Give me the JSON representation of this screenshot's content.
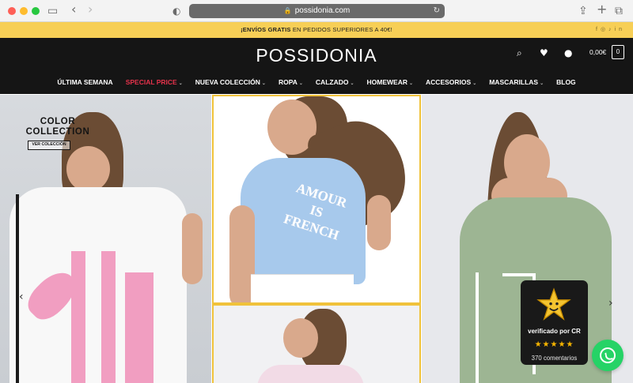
{
  "browser": {
    "url": "possidonia.com",
    "icons": [
      "sidebar-icon",
      "back-icon",
      "forward-icon",
      "shield-icon",
      "share-icon",
      "new-tab-icon",
      "tabs-icon",
      "reload-icon",
      "lock-icon"
    ]
  },
  "promo": {
    "bold": "¡ENVÍOS GRATIS",
    "rest": " EN PEDIDOS SUPERIORES A 40€!",
    "social_icons": [
      "facebook-icon",
      "instagram-icon",
      "tiktok-icon",
      "linkedin-icon"
    ]
  },
  "header": {
    "logo": "POSSIDONIA",
    "cart_total": "0,00€",
    "cart_count": "0",
    "icons": [
      "search-icon",
      "heart-icon",
      "user-icon",
      "cart-icon"
    ]
  },
  "nav": {
    "items": [
      {
        "label": "ÚLTIMA SEMANA",
        "dropdown": false
      },
      {
        "label": "SPECIAL PRICE",
        "dropdown": true,
        "active": true
      },
      {
        "label": "NUEVA COLECCIÓN",
        "dropdown": true
      },
      {
        "label": "ROPA",
        "dropdown": true
      },
      {
        "label": "CALZADO",
        "dropdown": true
      },
      {
        "label": "HOMEWEAR",
        "dropdown": true
      },
      {
        "label": "ACCESORIOS",
        "dropdown": true
      },
      {
        "label": "MASCARILLAS",
        "dropdown": true
      },
      {
        "label": "BLOG",
        "dropdown": false
      }
    ]
  },
  "hero": {
    "collection_line1": "COLOR",
    "collection_line2": "COLLECTION",
    "button": "VER COLECCIÓN",
    "tee_line1": "AMOUR",
    "tee_line2": "IS",
    "tee_line3": "FRENCH",
    "next_arrow": "›"
  },
  "review": {
    "verified": "verificado por CR",
    "rating": 5,
    "stars": "★★★★★",
    "count": "370 comentarios"
  },
  "colors": {
    "accent_yellow": "#f7cf56",
    "header_black": "#151515",
    "active_red": "#e5324b",
    "whatsapp_green": "#25d366"
  }
}
